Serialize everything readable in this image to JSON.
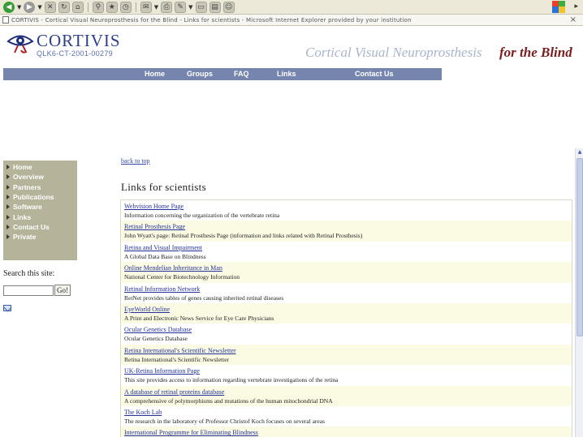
{
  "browser": {
    "address_text": "CORTIVIS - Cortical Visual Neuroprosthesis for the Blind - Links for scientists - Microsoft Internet Explorer provided by your institution"
  },
  "header": {
    "logo_name": "CORTIVIS",
    "project_code": "QLK6-CT-2001-00279",
    "tagline": "Cortical Visual Neuroprosthesis",
    "tagline_emphasis": "for the Blind"
  },
  "nav": {
    "items": [
      {
        "label": "Home"
      },
      {
        "label": "Groups"
      },
      {
        "label": "FAQ"
      },
      {
        "label": "Links"
      },
      {
        "label": "Contact Us"
      }
    ]
  },
  "sidebar": {
    "items": [
      {
        "label": "Home"
      },
      {
        "label": "Overview"
      },
      {
        "label": "Partners"
      },
      {
        "label": "Publications"
      },
      {
        "label": "Software"
      },
      {
        "label": "Links"
      },
      {
        "label": "Contact Us"
      },
      {
        "label": "Private"
      }
    ],
    "search_label": "Search this site:",
    "search_value": "",
    "search_button": "Go!"
  },
  "main": {
    "back_link": "back to top",
    "title": "Links for scientists",
    "links": [
      {
        "title": "Webvision Home Page",
        "desc": "Information concerning the organization of the vertebrate retina"
      },
      {
        "title": "Retinal Prosthesis Page",
        "desc": "John Wyatt's page: Retinal Prosthesis Page (information and links related with Retinal Prosthesis)"
      },
      {
        "title": "Retina and Visual Impairment",
        "desc": "A Global Data Base on Blindness"
      },
      {
        "title": "Online Mendelian Inheritance in Man",
        "desc": "National Center for Biotechnology Information"
      },
      {
        "title": "Retinal Information Network",
        "desc": "RetNet provides tables of genes causing inherited retinal diseases"
      },
      {
        "title": "EyeWorld Online",
        "desc": "A Print and Electronic News Service for Eye Care Physicians"
      },
      {
        "title": "Ocular Genetics Database",
        "desc": "Ocular Genetics Database"
      },
      {
        "title": "Retina International's Scientific Newsletter",
        "desc": "Retina International's Scientific Newsletter"
      },
      {
        "title": "UK-Retina Information Page",
        "desc": "This site provides access to information regarding vertebrate investigations of the retina"
      },
      {
        "title": "A database of retinal proteins database",
        "desc": "A comprehensive of polymorphisms and mutations of the human mitochondrial DNA"
      },
      {
        "title": "The Koch Lab",
        "desc": "The research in the laboratory of Professor Christof Koch focuses on several areas"
      },
      {
        "title": "International Programme for Eliminating Blindness",
        "desc": ""
      }
    ]
  }
}
